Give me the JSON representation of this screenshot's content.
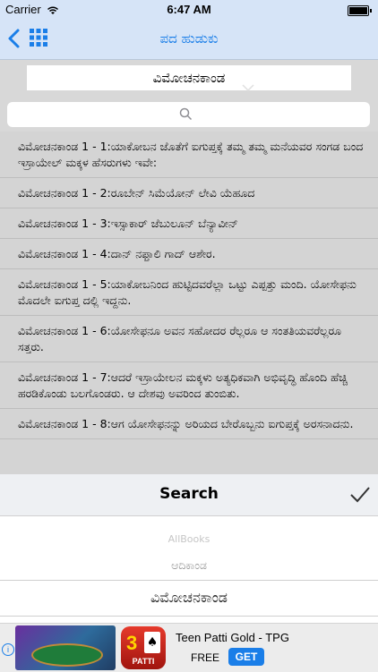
{
  "status_bar": {
    "carrier": "Carrier",
    "time": "6:47 AM"
  },
  "nav": {
    "title": "ಪದ ಹುಡುಕು",
    "accent": "#1a7ee8"
  },
  "book_selector": {
    "value": "ವಿಮೋಚನಕಾಂಡ"
  },
  "search": {
    "placeholder": ""
  },
  "verses": [
    "ವಿಮೋಚನಕಾಂಡ 1 - 1:ಯಾಕೋಬನ ಜೊತೆಗೆ ಐಗುಪ್ತಕ್ಕೆ ತಮ್ಮ ತಮ್ಮ ಮನೆಯವರ ಸಂಗಡ ಬಂದ ಇಸ್ರಾಯೇಲ್ ಮಕ್ಕಳ ಹೆಸರುಗಳು ಇವೇ:",
    "ವಿಮೋಚನಕಾಂಡ 1 - 2:ರೂಬೇನ್ ಸಿಮೆಯೋನ್ ಲೇವಿ ಯೆಹೂದ",
    "ವಿಮೋಚನಕಾಂಡ 1 - 3:ಇಸ್ಸಾಕಾರ್ ಜೆಬುಲೂನ್ ಬೆನ್ಯಾವೀನ್",
    "ವಿಮೋಚನಕಾಂಡ 1 - 4:ದಾನ್ ನಫ್ತಾಲಿ ಗಾದ್ ಆಶೇರ.",
    "ವಿಮೋಚನಕಾಂಡ 1 - 5:ಯಾಕೋಬನಿಂದ ಹುಟ್ಟಿದವರೆಲ್ಲಾ ಒಟ್ಟು ಎಪ್ಪತ್ತು ಮಂದಿ. ಯೋಸೇಫನು ಮೊದಲೇ ಐಗುಪ್ತ ದಲ್ಲಿ ಇದ್ದನು.",
    "ವಿಮೋಚನಕಾಂಡ 1 - 6:ಯೋಸೇಫನೂ ಅವನ ಸಹೋದರ ರೆಲ್ಲರೂ ಆ ಸಂತತಿಯವರೆಲ್ಲರೂ ಸತ್ತರು.",
    "ವಿಮೋಚನಕಾಂಡ 1 - 7:ಆದರೆ ಇಸ್ರಾಯೇಲನ ಮಕ್ಕಳು ಅತ್ಯಧಿಕವಾಗಿ ಅಭಿವೃದ್ಧಿ ಹೊಂದಿ ಹೆಚ್ಚಿ ಹರಡಿಕೊಂಡು ಬಲಗೊಂಡರು. ಆ ದೇಶವು ಅವರಿಂದ ತುಂಬಿತು.",
    "ವಿಮೋಚನಕಾಂಡ 1 - 8:ಆಗ ಯೋಸೇಫನನ್ನು ಅರಿಯದ ಬೇರೊಬ್ಬನು ಐಗುಪ್ತಕ್ಕೆ ಅರಸನಾದನು."
  ],
  "picker": {
    "title": "Search",
    "options": [
      "AllBooks",
      "ಆದಿಕಾಂಡ",
      "ವಿಮೋಚನಕಾಂಡ"
    ],
    "selected": "ವಿಮೋಚನಕಾಂಡ"
  },
  "ad": {
    "title": "Teen Patti Gold - TPG",
    "price": "FREE",
    "cta": "GET",
    "icon_numeral": "3",
    "icon_word": "PATTI"
  }
}
